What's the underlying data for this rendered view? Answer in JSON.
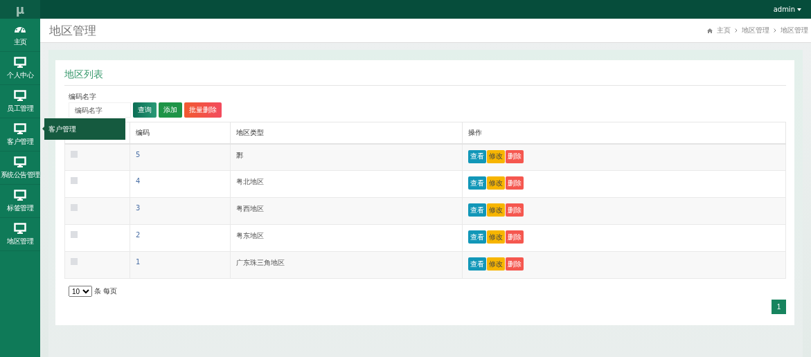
{
  "topbar": {
    "logo": "μ",
    "user": "admin"
  },
  "sidebar": {
    "items": [
      {
        "label": "主页",
        "kind": "dashboard"
      },
      {
        "label": "个人中心",
        "kind": "monitor"
      },
      {
        "label": "员工管理",
        "kind": "monitor"
      },
      {
        "label": "客户管理",
        "kind": "monitor"
      },
      {
        "label": "系统公告管理",
        "kind": "monitor"
      },
      {
        "label": "标签管理",
        "kind": "monitor"
      },
      {
        "label": "地区管理",
        "kind": "monitor"
      }
    ],
    "tooltip": {
      "label": "客户管理"
    }
  },
  "page_header": {
    "title": "地区管理",
    "breadcrumbs": [
      "主页",
      "地区管理",
      "地区管理"
    ]
  },
  "card": {
    "title": "地区列表",
    "search": {
      "label": "编码名字",
      "placeholder": "编码名字"
    },
    "buttons": [
      {
        "label": "查询",
        "kind": "search"
      },
      {
        "label": "添加",
        "kind": "add"
      },
      {
        "label": "批量删除",
        "kind": "delete"
      }
    ],
    "table": {
      "columns": [
        "编码",
        "地区类型",
        "操作"
      ],
      "rows": [
        {
          "checked": false,
          "code": "5",
          "type": "鄹",
          "actions": [
            "查看",
            "修改",
            "删除"
          ]
        },
        {
          "checked": false,
          "code": "4",
          "type": "粤北地区",
          "actions": [
            "查看",
            "修改",
            "删除"
          ]
        },
        {
          "checked": false,
          "code": "3",
          "type": "粤西地区",
          "actions": [
            "查看",
            "修改",
            "删除"
          ]
        },
        {
          "checked": false,
          "code": "2",
          "type": "粤东地区",
          "actions": [
            "查看",
            "修改",
            "删除"
          ]
        },
        {
          "checked": false,
          "code": "1",
          "type": "广东珠三角地区",
          "actions": [
            "查看",
            "修改",
            "删除"
          ]
        }
      ]
    },
    "page_size": {
      "value": "10",
      "suffix": "条 每页"
    },
    "pages": [
      {
        "label": "1",
        "selected": true
      }
    ]
  }
}
